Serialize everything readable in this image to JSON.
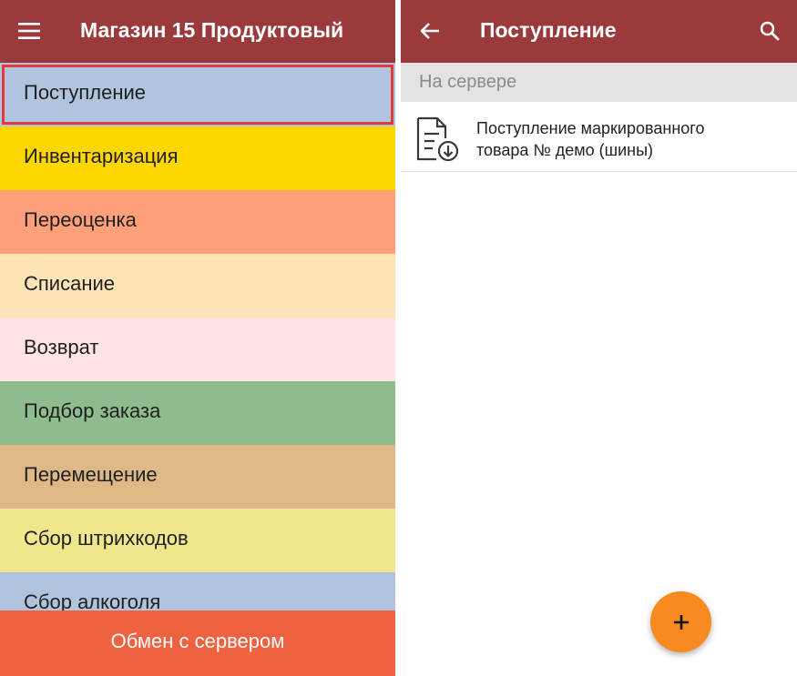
{
  "left_screen": {
    "header_title": "Магазин 15 Продуктовый",
    "menu_items": [
      {
        "label": "Поступление",
        "color": "#b0c4de"
      },
      {
        "label": "Инвентаризация",
        "color": "#ffd700"
      },
      {
        "label": "Переоценка",
        "color": "#ffa07a"
      },
      {
        "label": "Списание",
        "color": "#ffe4b5"
      },
      {
        "label": "Возврат",
        "color": "#ffe4e1"
      },
      {
        "label": "Подбор заказа",
        "color": "#8fbc8f"
      },
      {
        "label": "Перемещение",
        "color": "#deb887"
      },
      {
        "label": "Сбор штрихкодов",
        "color": "#f0e68c"
      },
      {
        "label": "Сбор алкоголя",
        "color": "#b0c4de"
      }
    ],
    "selected_index": 0,
    "bottom_button": "Обмен с сервером"
  },
  "right_screen": {
    "header_title": "Поступление",
    "section_header": "На сервере",
    "documents": [
      {
        "line1": "Поступление маркированного",
        "line2": "товара № демо (шины)",
        "icon": "document-download-icon"
      }
    ],
    "fab_icon": "plus-icon"
  },
  "colors": {
    "app_bar": "#9b3a3b",
    "accent_button": "#ef6240",
    "fab": "#f78b20",
    "selection_border": "#e23a3a"
  }
}
